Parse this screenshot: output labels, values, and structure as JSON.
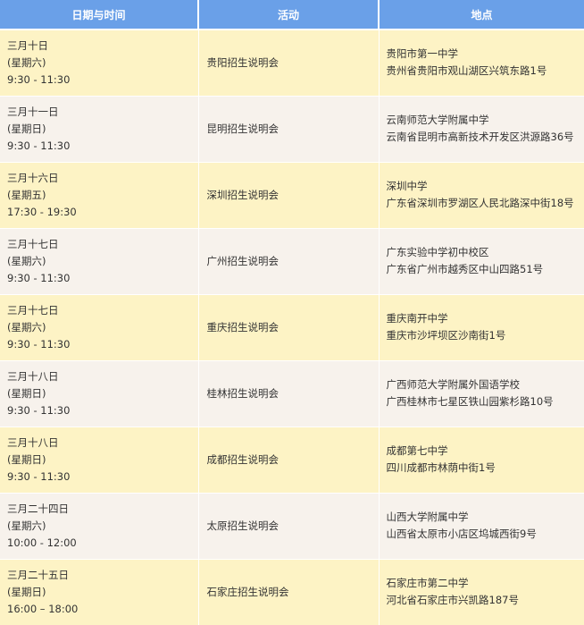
{
  "header": {
    "date_time": "日期与时间",
    "activity": "活动",
    "location": "地点"
  },
  "rows": [
    {
      "date": "三月十日",
      "weekday": "(星期六)",
      "time": "9:30 - 11:30",
      "activity": "贵阳招生说明会",
      "venue": "贵阳市第一中学",
      "address": "贵州省贵阳市观山湖区兴筑东路1号"
    },
    {
      "date": "三月十一日",
      "weekday": "(星期日)",
      "time": "9:30 - 11:30",
      "activity": "昆明招生说明会",
      "venue": "云南师范大学附属中学",
      "address": "云南省昆明市高新技术开发区洪源路36号"
    },
    {
      "date": "三月十六日",
      "weekday": "(星期五)",
      "time": "17:30 - 19:30",
      "activity": "深圳招生说明会",
      "venue": "深圳中学",
      "address": "广东省深圳市罗湖区人民北路深中街18号"
    },
    {
      "date": "三月十七日",
      "weekday": "(星期六)",
      "time": "9:30 - 11:30",
      "activity": "广州招生说明会",
      "venue": "广东实验中学初中校区",
      "address": "广东省广州市越秀区中山四路51号"
    },
    {
      "date": "三月十七日",
      "weekday": "(星期六)",
      "time": "9:30 - 11:30",
      "activity": "重庆招生说明会",
      "venue": "重庆南开中学",
      "address": "重庆市沙坪坝区沙南街1号"
    },
    {
      "date": "三月十八日",
      "weekday": "(星期日)",
      "time": "9:30 - 11:30",
      "activity": "桂林招生说明会",
      "venue": "广西师范大学附属外国语学校",
      "address": "广西桂林市七星区铁山园紫杉路10号"
    },
    {
      "date": "三月十八日",
      "weekday": "(星期日)",
      "time": "9:30 - 11:30",
      "activity": "成都招生说明会",
      "venue": "成都第七中学",
      "address": "四川成都市林荫中街1号"
    },
    {
      "date": "三月二十四日",
      "weekday": "(星期六)",
      "time": "10:00 - 12:00",
      "activity": "太原招生说明会",
      "venue": "山西大学附属中学",
      "address": "山西省太原市小店区坞城西街9号"
    },
    {
      "date": "三月二十五日",
      "weekday": "(星期日)",
      "time": "16:00 – 18:00",
      "activity": "石家庄招生说明会",
      "venue": "石家庄市第二中学",
      "address": "河北省石家庄市兴凯路187号"
    }
  ]
}
